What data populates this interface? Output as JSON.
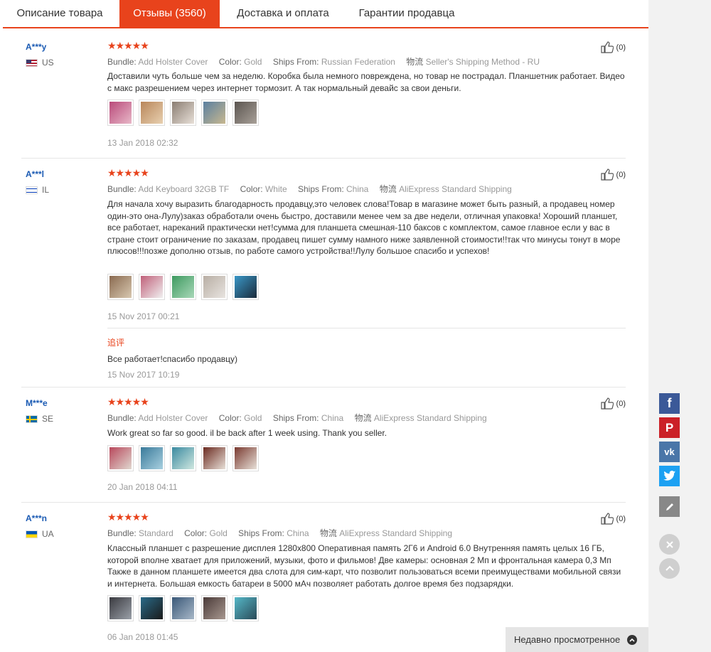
{
  "tabs": [
    {
      "label": "Описание товара",
      "active": false
    },
    {
      "label": "Отзывы (3560)",
      "active": true
    },
    {
      "label": "Доставка и оплата",
      "active": false
    },
    {
      "label": "Гарантии продавца",
      "active": false
    }
  ],
  "labels": {
    "bundle": "Bundle:",
    "color": "Color:",
    "ships_from": "Ships From:",
    "logistics": "物流"
  },
  "reviews": [
    {
      "user": "A***y",
      "country": "US",
      "rating": "★★★★★",
      "bundle": "Add Holster Cover",
      "color": "Gold",
      "ships_from": "Russian Federation",
      "shipping": "Seller's Shipping Method - RU",
      "text": "Доставили чуть больше чем за неделю. Коробка была немного повреждена, но товар не пострадал. Планшетник работает. Видео с макс разрешением через интернет тормозит. А так нормальный девайс за свои деньги.",
      "date": "13 Jan 2018 02:32",
      "likes": "(0)"
    },
    {
      "user": "A***l",
      "country": "IL",
      "rating": "★★★★★",
      "bundle": "Add Keyboard 32GB TF",
      "color": "White",
      "ships_from": "China",
      "shipping": "AliExpress Standard Shipping",
      "text": "Для начала хочу выразить благодарность продавцу,это человек слова!Товар в магазине может быть разный, а продавец номер один-это она-Лулу)заказ обработали очень быстро, доставили менее чем за две недели, отличная упаковка! Хороший планшет, все работает, нареканий практически нет!сумма для планшета смешная-110 баксов с комплектом, самое главное если у вас в стране стоит ограничение по заказам, продавец пишет сумму намного ниже заявленной стоимости!!так что минусы тонут в море плюсов!!!позже дополню отзыв, по работе самого устройства!!Лулу большое спасибо и успехов!",
      "date": "15 Nov 2017 00:21",
      "likes": "(0)",
      "followup_label": "追评",
      "followup_text": "Все работает!спасибо продавцу)",
      "followup_date": "15 Nov 2017 10:19"
    },
    {
      "user": "M***e",
      "country": "SE",
      "rating": "★★★★★",
      "bundle": "Add Holster Cover",
      "color": "Gold",
      "ships_from": "China",
      "shipping": "AliExpress Standard Shipping",
      "text": "Work great so far so good. il be back after 1 week using. Thank you seller.",
      "date": "20 Jan 2018 04:11",
      "likes": "(0)"
    },
    {
      "user": "A***n",
      "country": "UA",
      "rating": "★★★★★",
      "bundle": "Standard",
      "color": "Gold",
      "ships_from": "China",
      "shipping": "AliExpress Standard Shipping",
      "text": "Классный планшет с разрешение дисплея 1280x800 Оперативная память 2Г6 и Android 6.0 Внутренняя память целых 16 ГБ, которой вполне хватает для приложений, музыки, фото и фильмов! Две камеры: основная 2 Мп и фронтальная камера 0,3 Мп Также в данном планшете имеется два слота для сим-карт, что позволит пользоваться всеми преимуществами мобильной связи и интернета. Большая емкость батареи в 5000 мАч позволяет работать долгое время без подзарядки.",
      "date": "06 Jan 2018 01:45",
      "likes": "(0)"
    }
  ],
  "thumb_colors": [
    [
      "#b94a7a",
      "#b8865a",
      "#8a7d72",
      "#5a7fa0",
      "#5b5550"
    ],
    [
      "#8a6a50",
      "#c0607a",
      "#3e9a60",
      "#b8aea4",
      "#3a98c8"
    ],
    [
      "#b8485c",
      "#3a7a9a",
      "#3a8aa0",
      "#6b2a20",
      "#7a3a30"
    ],
    [
      "#3a3a40",
      "#2a6a88",
      "#3a5878",
      "#4a3a38",
      "#55b8c8"
    ]
  ],
  "social": {
    "facebook": {
      "icon": "facebook-icon",
      "color": "#3b5998",
      "glyph": "f"
    },
    "pinterest": {
      "icon": "pinterest-icon",
      "color": "#cb2027",
      "glyph": "P"
    },
    "vk": {
      "icon": "vk-icon",
      "color": "#4a76a8",
      "glyph": "vk"
    },
    "twitter": {
      "icon": "twitter-icon",
      "color": "#1da1f2",
      "glyph": "t"
    }
  },
  "recently_viewed": "Недавно просмотренное",
  "colors": {
    "accent": "#e8431c",
    "username": "#1a5ab3"
  }
}
